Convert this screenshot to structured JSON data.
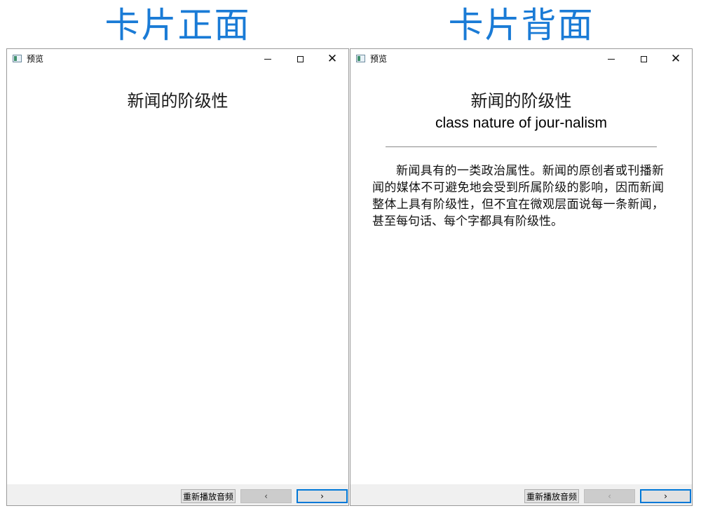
{
  "captions": {
    "front": "卡片正面",
    "back": "卡片背面"
  },
  "window": {
    "title": "预览",
    "icon": "app-icon",
    "controls": {
      "minimize": "minimize-icon",
      "maximize": "maximize-icon",
      "close": "close-icon"
    }
  },
  "front_card": {
    "term_cn": "新闻的阶级性"
  },
  "back_card": {
    "term_cn": "新闻的阶级性",
    "term_en": "class nature of jour-nalism",
    "definition": "新闻具有的一类政治属性。新闻的原创者或刊播新闻的媒体不可避免地会受到所属阶级的影响，因而新闻整体上具有阶级性，但不宜在微观层面说每一条新闻，甚至每句话、每个字都具有阶级性。"
  },
  "footer": {
    "replay_label": "重新播放音频",
    "prev_label": "‹",
    "next_label": "›"
  },
  "colors": {
    "caption": "#1a7bd6",
    "next_button_border": "#0078d7"
  }
}
